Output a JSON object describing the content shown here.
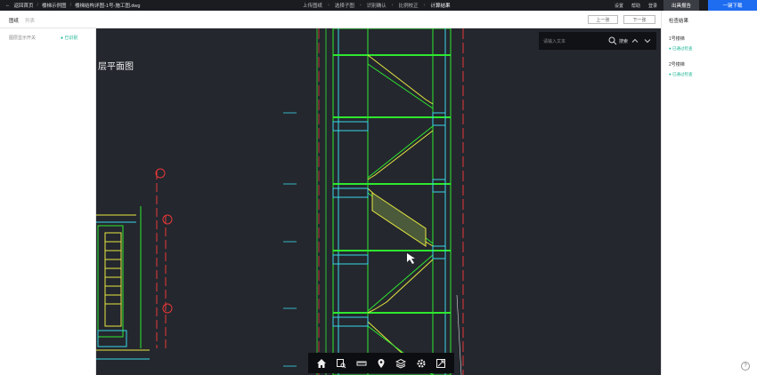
{
  "topbar": {
    "back_label": "返回首页",
    "sep1": "/",
    "breadcrumb_project": "楼梯示例图",
    "sep2": "/",
    "filename": "楼梯结构详图-1号-施工图.dwg",
    "steps": [
      "上传图纸",
      "选择子图",
      "识别确认",
      "比例校正",
      "计算结果"
    ],
    "step_sep": "›",
    "right_links": [
      "设置",
      "帮助",
      "登录"
    ],
    "review_button": "出具报告",
    "download_button": "一键下载"
  },
  "subbar": {
    "tab_active": "图纸",
    "tab_inactive": "列表",
    "btn_prev": "上一张",
    "btn_next": "下一张"
  },
  "left_panel": {
    "legend_label": "图层显示开关",
    "legend_status": "● 已识别"
  },
  "canvas": {
    "floor_plan_title": "层平面图"
  },
  "search": {
    "placeholder": "请输入文本",
    "search_label": "搜索"
  },
  "right_panel": {
    "title": "检查结果",
    "sections": [
      {
        "heading": "1号楼梯",
        "item": "● 已通过检查"
      },
      {
        "heading": "2号楼梯",
        "item": "● 已通过检查"
      }
    ]
  },
  "help_label": "?",
  "colors": {
    "topbar": "#1a1c20",
    "canvas": "#24272e",
    "accent_blue": "#1e6cf0",
    "cad_green": "#2ee82e",
    "cad_yellow": "#e8e840",
    "cad_cyan": "#38d8e8",
    "cad_red": "#e83838",
    "status_green": "#1ab394"
  }
}
